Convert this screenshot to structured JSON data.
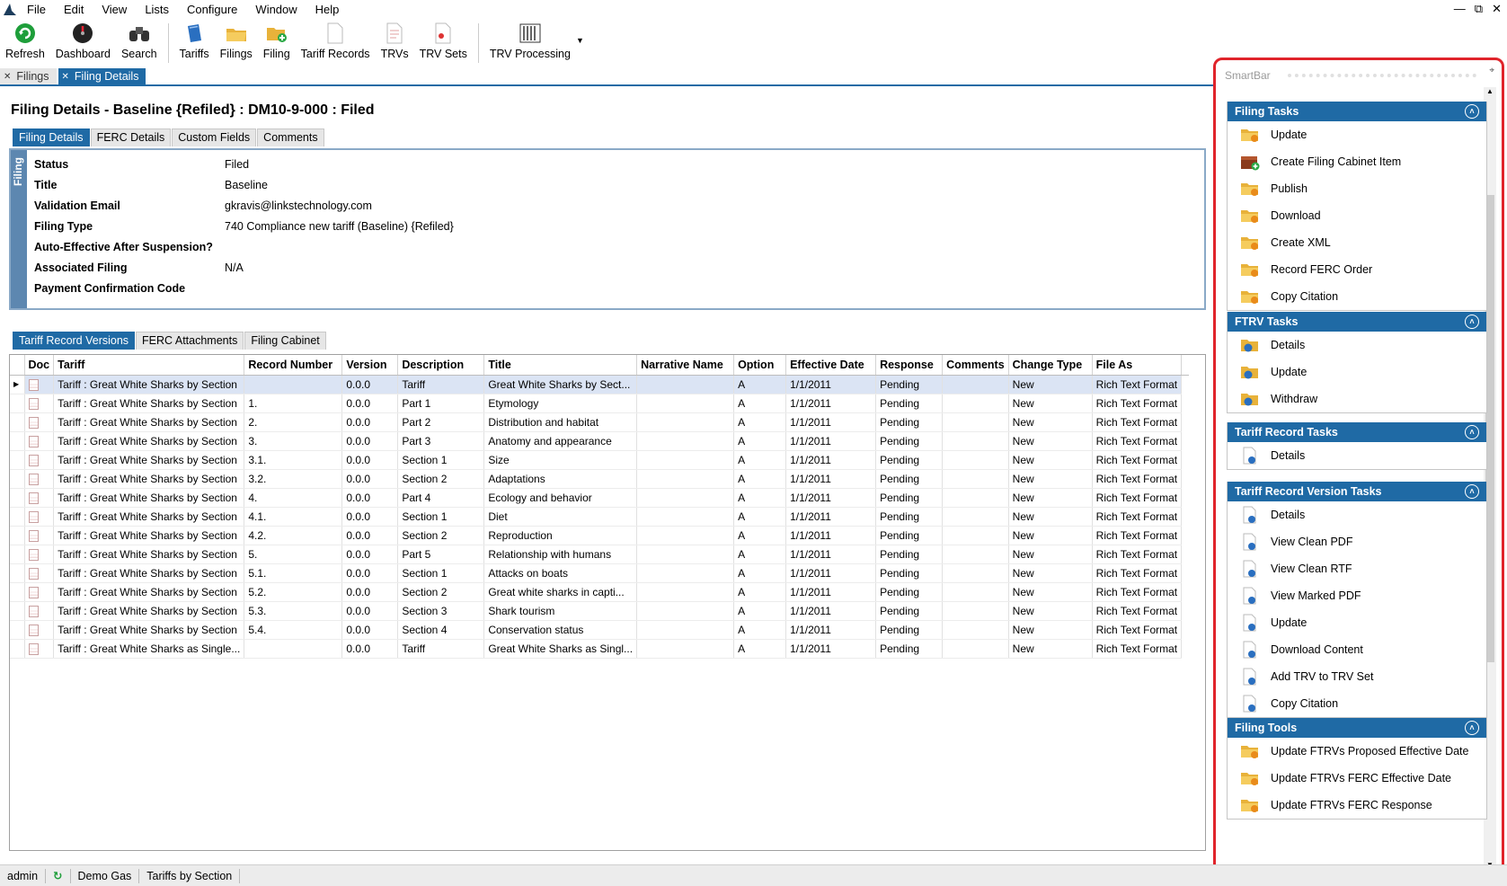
{
  "menu": [
    "File",
    "Edit",
    "View",
    "Lists",
    "Configure",
    "Window",
    "Help"
  ],
  "toolbar": [
    {
      "label": "Refresh",
      "icon": "refresh-icon"
    },
    {
      "label": "Dashboard",
      "icon": "dashboard-icon"
    },
    {
      "label": "Search",
      "icon": "binoculars-icon"
    },
    {
      "label": "Tariffs",
      "icon": "tariffs-icon"
    },
    {
      "label": "Filings",
      "icon": "filings-icon"
    },
    {
      "label": "Filing",
      "icon": "new-filing-icon"
    },
    {
      "label": "Tariff Records",
      "icon": "tariff-records-icon"
    },
    {
      "label": "TRVs",
      "icon": "trvs-icon"
    },
    {
      "label": "TRV Sets",
      "icon": "trv-sets-icon"
    },
    {
      "label": "TRV Processing",
      "icon": "trv-processing-icon"
    }
  ],
  "doc_tabs": [
    {
      "label": "Filings",
      "active": false
    },
    {
      "label": "Filing Details",
      "active": true
    }
  ],
  "page_title": "Filing Details - Baseline {Refiled} : DM10-9-000 : Filed",
  "detail_tabs": [
    "Filing Details",
    "FERC Details",
    "Custom Fields",
    "Comments"
  ],
  "details_side_label": "Filing",
  "details": [
    {
      "label": "Status",
      "value": "Filed"
    },
    {
      "label": "Title",
      "value": "Baseline"
    },
    {
      "label": "Validation Email",
      "value": "gkravis@linkstechnology.com"
    },
    {
      "label": "Filing Type",
      "value": "740 Compliance new tariff (Baseline) {Refiled}"
    },
    {
      "label": "Auto-Effective After Suspension?",
      "value": ""
    },
    {
      "label": "Associated Filing",
      "value": "N/A"
    },
    {
      "label": "Payment Confirmation Code",
      "value": ""
    }
  ],
  "grid_tabs": [
    "Tariff Record Versions",
    "FERC Attachments",
    "Filing Cabinet"
  ],
  "grid": {
    "columns": [
      "Doc",
      "Tariff",
      "Record Number",
      "Version",
      "Description",
      "Title",
      "Narrative Name",
      "Option",
      "Effective Date",
      "Response",
      "Comments",
      "Change Type",
      "File As"
    ],
    "rows": [
      [
        "Tariff : Great White Sharks by Section",
        "",
        "0.0.0",
        "Tariff",
        "Great White Sharks by Sect...",
        "",
        "A",
        "1/1/2011",
        "Pending",
        "",
        "New",
        "Rich Text Format"
      ],
      [
        "Tariff : Great White Sharks by Section",
        "1.",
        "0.0.0",
        "Part 1",
        "Etymology",
        "",
        "A",
        "1/1/2011",
        "Pending",
        "",
        "New",
        "Rich Text Format"
      ],
      [
        "Tariff : Great White Sharks by Section",
        "2.",
        "0.0.0",
        "Part 2",
        "Distribution and habitat",
        "",
        "A",
        "1/1/2011",
        "Pending",
        "",
        "New",
        "Rich Text Format"
      ],
      [
        "Tariff : Great White Sharks by Section",
        "3.",
        "0.0.0",
        "Part 3",
        "Anatomy and appearance",
        "",
        "A",
        "1/1/2011",
        "Pending",
        "",
        "New",
        "Rich Text Format"
      ],
      [
        "Tariff : Great White Sharks by Section",
        "3.1.",
        "0.0.0",
        "Section 1",
        "Size",
        "",
        "A",
        "1/1/2011",
        "Pending",
        "",
        "New",
        "Rich Text Format"
      ],
      [
        "Tariff : Great White Sharks by Section",
        "3.2.",
        "0.0.0",
        "Section 2",
        "Adaptations",
        "",
        "A",
        "1/1/2011",
        "Pending",
        "",
        "New",
        "Rich Text Format"
      ],
      [
        "Tariff : Great White Sharks by Section",
        "4.",
        "0.0.0",
        "Part 4",
        "Ecology and behavior",
        "",
        "A",
        "1/1/2011",
        "Pending",
        "",
        "New",
        "Rich Text Format"
      ],
      [
        "Tariff : Great White Sharks by Section",
        "4.1.",
        "0.0.0",
        "Section 1",
        "Diet",
        "",
        "A",
        "1/1/2011",
        "Pending",
        "",
        "New",
        "Rich Text Format"
      ],
      [
        "Tariff : Great White Sharks by Section",
        "4.2.",
        "0.0.0",
        "Section 2",
        "Reproduction",
        "",
        "A",
        "1/1/2011",
        "Pending",
        "",
        "New",
        "Rich Text Format"
      ],
      [
        "Tariff : Great White Sharks by Section",
        "5.",
        "0.0.0",
        "Part 5",
        "Relationship with humans",
        "",
        "A",
        "1/1/2011",
        "Pending",
        "",
        "New",
        "Rich Text Format"
      ],
      [
        "Tariff : Great White Sharks by Section",
        "5.1.",
        "0.0.0",
        "Section 1",
        "Attacks on boats",
        "",
        "A",
        "1/1/2011",
        "Pending",
        "",
        "New",
        "Rich Text Format"
      ],
      [
        "Tariff : Great White Sharks by Section",
        "5.2.",
        "0.0.0",
        "Section 2",
        "Great white sharks in capti...",
        "",
        "A",
        "1/1/2011",
        "Pending",
        "",
        "New",
        "Rich Text Format"
      ],
      [
        "Tariff : Great White Sharks by Section",
        "5.3.",
        "0.0.0",
        "Section 3",
        "Shark tourism",
        "",
        "A",
        "1/1/2011",
        "Pending",
        "",
        "New",
        "Rich Text Format"
      ],
      [
        "Tariff : Great White Sharks by Section",
        "5.4.",
        "0.0.0",
        "Section 4",
        "Conservation status",
        "",
        "A",
        "1/1/2011",
        "Pending",
        "",
        "New",
        "Rich Text Format"
      ],
      [
        "Tariff : Great White Sharks as Single...",
        "",
        "0.0.0",
        "Tariff",
        "Great White Sharks as Singl...",
        "",
        "A",
        "1/1/2011",
        "Pending",
        "",
        "New",
        "Rich Text Format"
      ]
    ]
  },
  "smartbar": {
    "title": "SmartBar",
    "sections": [
      {
        "title": "Filing Tasks",
        "items": [
          {
            "label": "Update",
            "icon": "folder-update-icon"
          },
          {
            "label": "Create Filing Cabinet Item",
            "icon": "filing-cabinet-add-icon"
          },
          {
            "label": "Publish",
            "icon": "folder-publish-icon"
          },
          {
            "label": "Download",
            "icon": "folder-download-icon"
          },
          {
            "label": "Create XML",
            "icon": "folder-xml-icon"
          },
          {
            "label": "Record FERC Order",
            "icon": "folder-order-icon"
          },
          {
            "label": "Copy Citation",
            "icon": "folder-citation-icon"
          }
        ]
      },
      {
        "title": "FTRV Tasks",
        "items": [
          {
            "label": "Details",
            "icon": "ftrv-details-icon"
          },
          {
            "label": "Update",
            "icon": "ftrv-update-icon"
          },
          {
            "label": "Withdraw",
            "icon": "ftrv-withdraw-icon"
          }
        ]
      },
      {
        "title": "Tariff Record Tasks",
        "items": [
          {
            "label": "Details",
            "icon": "record-details-icon"
          }
        ]
      },
      {
        "title": "Tariff Record Version Tasks",
        "items": [
          {
            "label": "Details",
            "icon": "version-details-icon"
          },
          {
            "label": "View Clean PDF",
            "icon": "pdf-icon"
          },
          {
            "label": "View Clean RTF",
            "icon": "rtf-icon"
          },
          {
            "label": "View Marked PDF",
            "icon": "marked-pdf-icon"
          },
          {
            "label": "Update",
            "icon": "version-update-icon"
          },
          {
            "label": "Download Content",
            "icon": "download-content-icon"
          },
          {
            "label": "Add TRV to TRV Set",
            "icon": "add-trv-icon"
          },
          {
            "label": "Copy Citation",
            "icon": "version-citation-icon"
          }
        ]
      },
      {
        "title": "Filing Tools",
        "items": [
          {
            "label": "Update FTRVs Proposed Effective Date",
            "icon": "tool-date-icon"
          },
          {
            "label": "Update FTRVs FERC Effective Date",
            "icon": "tool-ferc-date-icon"
          },
          {
            "label": "Update FTRVs FERC Response",
            "icon": "tool-response-icon"
          }
        ]
      }
    ]
  },
  "status": [
    "admin",
    "Demo Gas",
    "Tariffs by Section"
  ],
  "colors": {
    "accent": "#1f6aa5",
    "highlight": "#e0242b",
    "selected_row": "#dbe4f4"
  }
}
